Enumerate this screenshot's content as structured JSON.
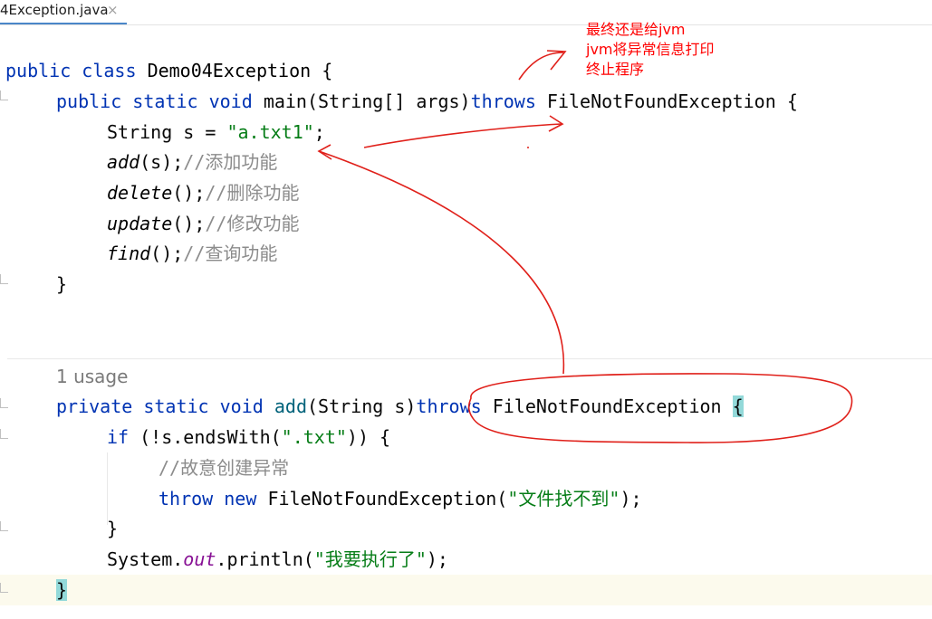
{
  "tab": {
    "title": "4Exception.java",
    "close_glyph": "×"
  },
  "code": {
    "class_line": {
      "kw1": "public",
      "kw2": "class",
      "name": "Demo04Exception",
      "brace": "{"
    },
    "main_line": {
      "kw1": "public",
      "kw2": "static",
      "kw3": "void",
      "name": "main",
      "params": "(String[] args)",
      "throws_kw": "throws",
      "exc": "FileNotFoundException",
      "brace": "{"
    },
    "string_line": {
      "type": "String",
      "rest": " s = ",
      "value": "\"a.txt1\"",
      "end": ";"
    },
    "add_call": {
      "name": "add",
      "args": "(s);",
      "comment": "//添加功能"
    },
    "delete_call": {
      "name": "delete",
      "args": "();",
      "comment": "//删除功能"
    },
    "update_call": {
      "name": "update",
      "args": "();",
      "comment": "//修改功能"
    },
    "find_call": {
      "name": "find",
      "args": "();",
      "comment": "//查询功能"
    },
    "close_main": "}",
    "usage_hint": "1 usage",
    "add_decl": {
      "kw1": "private",
      "kw2": "static",
      "kw3": "void",
      "name": "add",
      "params": "(String s)",
      "throws_kw": "throws",
      "exc": "FileNotFoundException",
      "brace": "{"
    },
    "if_line": {
      "kw": "if",
      "cond": " (!s.endsWith(",
      "str": "\".txt\"",
      "end": ")) {"
    },
    "comment_line": "//故意创建异常",
    "throw_line": {
      "kw1": "throw",
      "kw2": "new",
      "cls": "FileNotFoundException(",
      "str": "\"文件找不到\"",
      "end": ");"
    },
    "close_if": "}",
    "print_line": {
      "obj": "System.",
      "field": "out",
      "call": ".println(",
      "str": "\"我要执行了\"",
      "end": ");"
    },
    "close_add": "}"
  },
  "annotation": {
    "lines": [
      "最终还是给jvm",
      "jvm将异常信息打印",
      "终止程序"
    ],
    "color": "#ff0000"
  },
  "colors": {
    "keyword": "#0033b3",
    "string": "#067d17",
    "comment": "#8c8c8c",
    "field": "#871094",
    "brace_highlight": "#93d9d9"
  }
}
